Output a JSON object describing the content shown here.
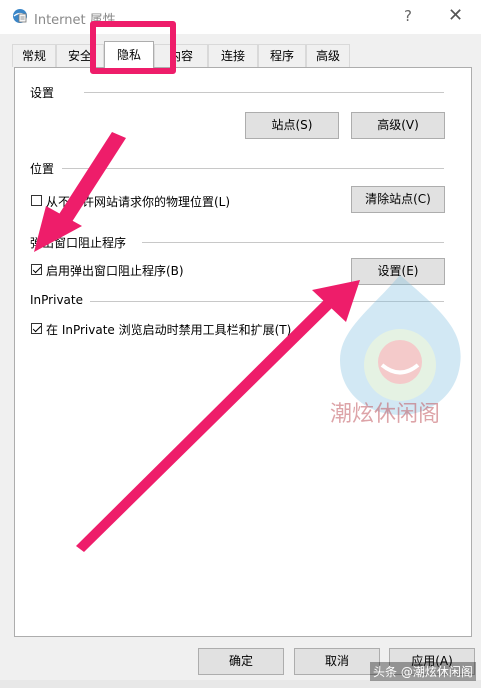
{
  "window": {
    "title": "Internet 属性",
    "help_glyph": "?",
    "close_glyph": "✕"
  },
  "tabs": [
    {
      "label": "常规"
    },
    {
      "label": "安全"
    },
    {
      "label": "隐私",
      "active": true
    },
    {
      "label": "内容"
    },
    {
      "label": "连接"
    },
    {
      "label": "程序"
    },
    {
      "label": "高级"
    }
  ],
  "settings_section": {
    "header": "设置",
    "sites_button": "站点(S)",
    "advanced_button": "高级(V)"
  },
  "location_section": {
    "header": "位置",
    "checkbox_label": "从不允许网站请求你的物理位置(L)",
    "checkbox_checked": false,
    "clear_sites_button": "清除站点(C)"
  },
  "popup_section": {
    "header": "弹出窗口阻止程序",
    "checkbox_label": "启用弹出窗口阻止程序(B)",
    "checkbox_checked": true,
    "settings_button": "设置(E)"
  },
  "inprivate_section": {
    "header": "InPrivate",
    "checkbox_label": "在 InPrivate 浏览启动时禁用工具栏和扩展(T)",
    "checkbox_checked": true
  },
  "footer": {
    "ok_button": "确定",
    "cancel_button": "取消",
    "apply_button": "应用(A)"
  },
  "watermark": {
    "text": "潮炫休闲阁",
    "credit": "头条 @潮炫休闲阁"
  },
  "colors": {
    "annotation": "#ee1d6a",
    "button_bg": "#e1e1e1",
    "panel_bg": "#ffffff"
  }
}
